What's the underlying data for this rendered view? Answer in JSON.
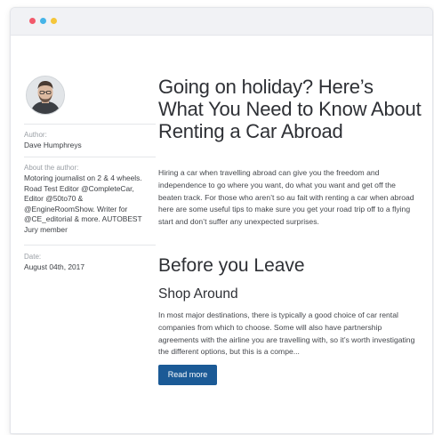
{
  "colors": {
    "dot_red": "#f2596b",
    "dot_blue": "#46b4e8",
    "dot_yellow": "#f5c63a",
    "button_bg": "#1b5a96"
  },
  "window": {
    "controls": [
      "close-dot",
      "minimize-dot",
      "maximize-dot"
    ]
  },
  "author": {
    "avatar_icon": "author-photo",
    "author_label": "Author:",
    "author_name": "Dave Humphreys",
    "about_label": "About the author:",
    "about_text": "Motoring journalist on 2 & 4 wheels. Road Test Editor @CompleteCar, Editor @50to70 & @EngineRoomShow. Writer for @CE_editorial & more. AUTOBEST Jury member",
    "date_label": "Date:",
    "date_value": "August 04th, 2017"
  },
  "article": {
    "title": "Going on holiday? Here’s What You Need to Know About Renting a Car Abroad",
    "intro": "Hiring a car when travelling abroad can give you the freedom and independence to go where you want, do what you want and get off the beaten track. For those who aren’t so au fait with renting a car when abroad here are some useful tips to make sure you get your road trip off to a flying start and don’t suffer any unexpected surprises.",
    "section_heading": "Before you Leave",
    "subsection_heading": "Shop Around",
    "body": "In most major destinations, there is typically a good choice of car rental companies from which to choose. Some will also have partnership agreements with the airline you are travelling with, so it’s worth investigating the different options, but this is a compe...",
    "read_more_label": "Read more"
  }
}
